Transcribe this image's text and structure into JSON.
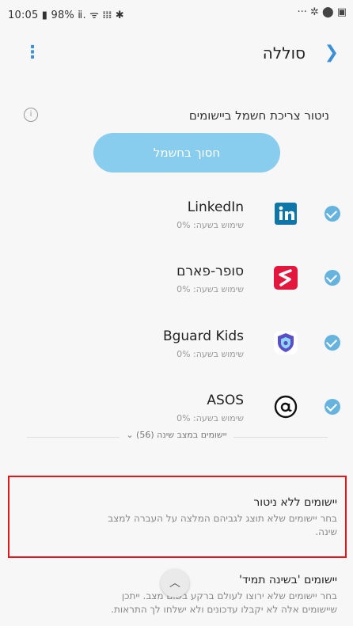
{
  "status_bar": {
    "left": "10:05 ▮ 98% ⅱ. ᯤ 𝍖 ✱",
    "right": "··· ✲ ⬤ ▣"
  },
  "header": {
    "title": "סוללה",
    "back_glyph": "❯",
    "menu_glyph": "⋮"
  },
  "subtitle": "ניטור צריכת חשמל ביישומים",
  "info_glyph": "i",
  "save_button": "חסוך בחשמל",
  "apps": [
    {
      "name": "LinkedIn",
      "usage": "שימוש בשעה: 0%",
      "icon": "linkedin-icon",
      "checked": true
    },
    {
      "name": "סופר-פארם",
      "usage": "שימוש בשעה: 0%",
      "icon": "superpharm-icon",
      "checked": true
    },
    {
      "name": "Bguard Kids",
      "usage": "שימוש בשעה: 0%",
      "icon": "bguard-shield-icon",
      "checked": true
    },
    {
      "name": "ASOS",
      "usage": "שימוש בשעה: 0%",
      "icon": "asos-icon",
      "checked": true
    }
  ],
  "sleeping_apps_link": "יישומים במצב שינה (56) ⌄",
  "unmonitored": {
    "title": "יישומים ללא ניטור",
    "desc": "בחר יישומים שלא תוצג לגביהם המלצה על העברה למצב שינה."
  },
  "always_sleeping": {
    "title": "יישומים 'בשינה תמיד'",
    "desc": "בחר יישומים שלא ירוצו לעולם ברקע בשום מצב. ייתכן שיישומים אלה לא יקבלו עדכונים ולא ישלחו לך התראות."
  },
  "scroll_top_glyph": "︿",
  "colors": {
    "accent": "#3a8fd8",
    "button": "#88cdee",
    "check": "#66b3de",
    "highlight": "#e3171b"
  }
}
